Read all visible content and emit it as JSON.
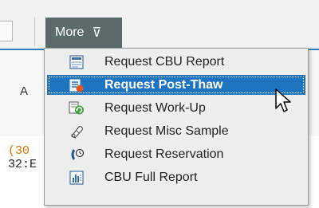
{
  "toolbar": {
    "more_label": "More",
    "more_chevron": "⊽"
  },
  "background": {
    "column_letter": "A",
    "text_line1": "(30",
    "text_line2": "32:E"
  },
  "menu": {
    "items": [
      {
        "label": "Request CBU Report",
        "icon": "report-document-icon",
        "highlighted": false
      },
      {
        "label": "Request Post-Thaw",
        "icon": "post-thaw-request-icon",
        "highlighted": true
      },
      {
        "label": "Request Work-Up",
        "icon": "work-up-refresh-icon",
        "highlighted": false
      },
      {
        "label": "Request Misc Sample",
        "icon": "misc-sample-icon",
        "highlighted": false
      },
      {
        "label": "Request Reservation",
        "icon": "reservation-phone-clock-icon",
        "highlighted": false
      },
      {
        "label": "CBU Full Report",
        "icon": "bar-chart-report-icon",
        "highlighted": false
      }
    ]
  },
  "colors": {
    "accent": "#1f74bf",
    "more_button_bg": "#5b6b6b",
    "menu_bg": "#eeeeee"
  }
}
